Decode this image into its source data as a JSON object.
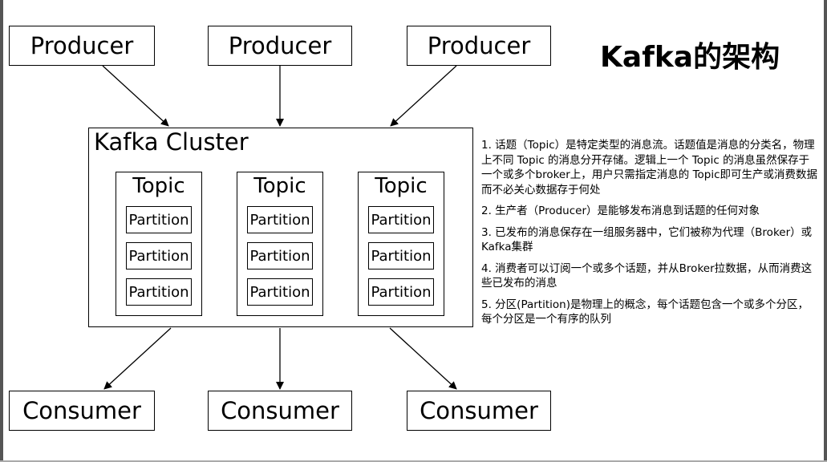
{
  "title": "Kafka的架构",
  "producers": [
    {
      "label": "Producer"
    },
    {
      "label": "Producer"
    },
    {
      "label": "Producer"
    }
  ],
  "cluster": {
    "label": "Kafka Cluster",
    "topics": [
      {
        "label": "Topic",
        "partitions": [
          "Partition",
          "Partition",
          "Partition"
        ]
      },
      {
        "label": "Topic",
        "partitions": [
          "Partition",
          "Partition",
          "Partition"
        ]
      },
      {
        "label": "Topic",
        "partitions": [
          "Partition",
          "Partition",
          "Partition"
        ]
      }
    ]
  },
  "consumers": [
    {
      "label": "Consumer"
    },
    {
      "label": "Consumer"
    },
    {
      "label": "Consumer"
    }
  ],
  "notes": [
    "1. 话题（Topic）是特定类型的消息流。话题值是消息的分类名，物理上不同 Topic 的消息分开存储。逻辑上一个 Topic 的消息虽然保存于一个或多个broker上，用户只需指定消息的 Topic即可生产或消费数据而不必关心数据存于何处",
    "2. 生产者（Producer）是能够发布消息到话题的任何对象",
    "3. 已发布的消息保存在一组服务器中，它们被称为代理（Broker）或Kafka集群",
    "4. 消费者可以订阅一个或多个话题，并从Broker拉数据，从而消费这些已发布的消息",
    "5. 分区(Partition)是物理上的概念，每个话题包含一个或多个分区，每个分区是一个有序的队列"
  ]
}
